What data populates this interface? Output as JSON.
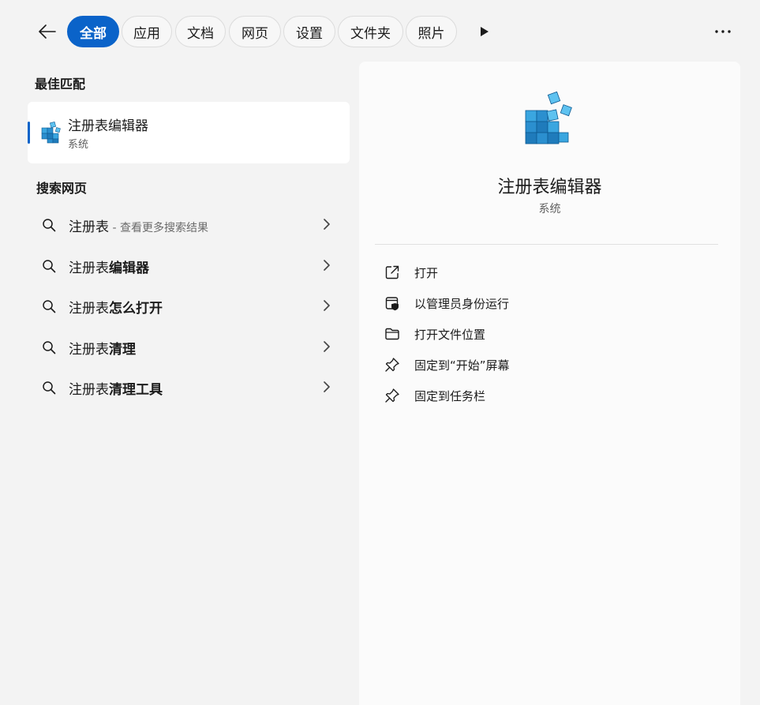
{
  "filters": {
    "tabs": [
      {
        "label": "全部",
        "active": true
      },
      {
        "label": "应用"
      },
      {
        "label": "文档"
      },
      {
        "label": "网页"
      },
      {
        "label": "设置"
      },
      {
        "label": "文件夹"
      },
      {
        "label": "照片"
      }
    ],
    "icons": {
      "back": "arrow-left-icon",
      "more_tabs": "play-icon",
      "more": "ellipsis-icon"
    }
  },
  "best_match": {
    "heading": "最佳匹配",
    "app_name": "注册表编辑器",
    "app_type": "系统",
    "icon": "registry-editor-icon"
  },
  "web_search": {
    "heading": "搜索网页",
    "results": [
      {
        "prefix": "注册表",
        "bold": "",
        "hint": " - 查看更多搜索结果"
      },
      {
        "prefix": "注册表",
        "bold": "编辑器",
        "hint": ""
      },
      {
        "prefix": "注册表",
        "bold": "怎么打开",
        "hint": ""
      },
      {
        "prefix": "注册表",
        "bold": "清理",
        "hint": ""
      },
      {
        "prefix": "注册表",
        "bold": "清理工具",
        "hint": ""
      }
    ]
  },
  "detail": {
    "title": "注册表编辑器",
    "subtitle": "系统",
    "actions": [
      {
        "label": "打开",
        "icon": "open-external-icon"
      },
      {
        "label": "以管理员身份运行",
        "icon": "admin-shield-icon"
      },
      {
        "label": "打开文件位置",
        "icon": "folder-icon"
      },
      {
        "label": "固定到“开始”屏幕",
        "icon": "pin-icon"
      },
      {
        "label": "固定到任务栏",
        "icon": "pin-icon"
      }
    ]
  },
  "colors": {
    "accent": "#0a63c9",
    "panel": "#fbfbfb",
    "background": "#f3f3f3"
  }
}
